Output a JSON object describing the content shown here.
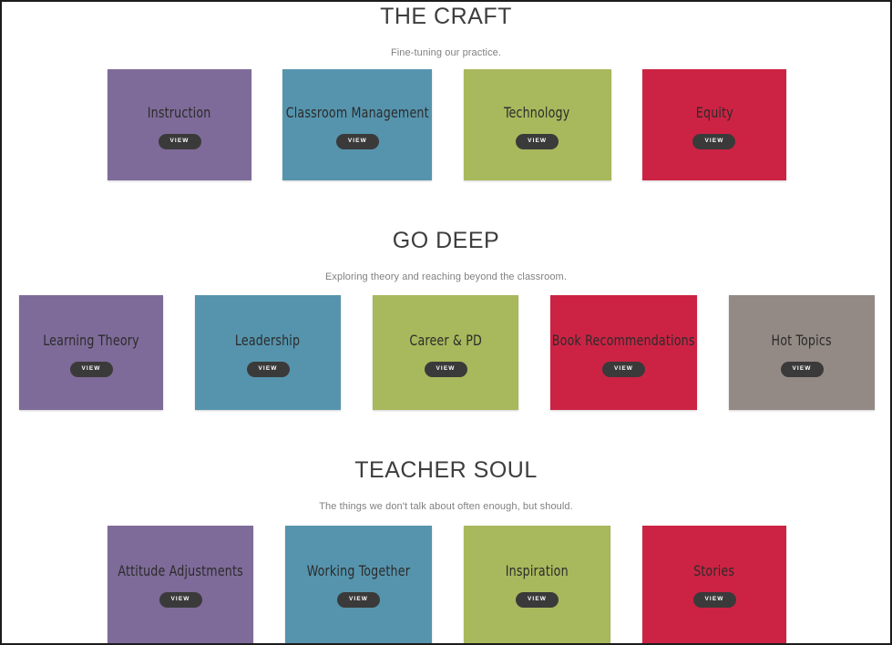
{
  "page": {
    "background": "#ffffff",
    "border_color": "#1c1c1c"
  },
  "palette": {
    "purple": "#7e6b99",
    "teal": "#5694ad",
    "green": "#a8b85c",
    "red": "#cc2344",
    "gray": "#938a85",
    "button_bg": "#3b3a3a",
    "button_text": "#ffffff",
    "title_color": "#3d3d3d",
    "subtitle_color": "#808080",
    "card_text_color": "#2b2b2b"
  },
  "sections": [
    {
      "id": "the-craft",
      "title": "THE CRAFT",
      "subtitle": "Fine-tuning our practice.",
      "cards": [
        {
          "label": "Instruction",
          "color_key": "purple",
          "button": "VIEW"
        },
        {
          "label": "Classroom Management",
          "color_key": "teal",
          "button": "VIEW"
        },
        {
          "label": "Technology",
          "color_key": "green",
          "button": "VIEW"
        },
        {
          "label": "Equity",
          "color_key": "red",
          "button": "VIEW"
        }
      ]
    },
    {
      "id": "go-deep",
      "title": "GO DEEP",
      "subtitle": "Exploring theory and reaching beyond the classroom.",
      "cards": [
        {
          "label": "Learning Theory",
          "color_key": "purple",
          "button": "VIEW"
        },
        {
          "label": "Leadership",
          "color_key": "teal",
          "button": "VIEW"
        },
        {
          "label": "Career & PD",
          "color_key": "green",
          "button": "VIEW"
        },
        {
          "label": "Book Recommendations",
          "color_key": "red",
          "button": "VIEW"
        },
        {
          "label": "Hot Topics",
          "color_key": "gray",
          "button": "VIEW"
        }
      ]
    },
    {
      "id": "teacher-soul",
      "title": "TEACHER SOUL",
      "subtitle": "The things we don't talk about often enough, but should.",
      "cards": [
        {
          "label": "Attitude Adjustments",
          "color_key": "purple",
          "button": "VIEW"
        },
        {
          "label": "Working Together",
          "color_key": "teal",
          "button": "VIEW"
        },
        {
          "label": "Inspiration",
          "color_key": "green",
          "button": "VIEW"
        },
        {
          "label": "Stories",
          "color_key": "red",
          "button": "VIEW"
        }
      ]
    }
  ]
}
